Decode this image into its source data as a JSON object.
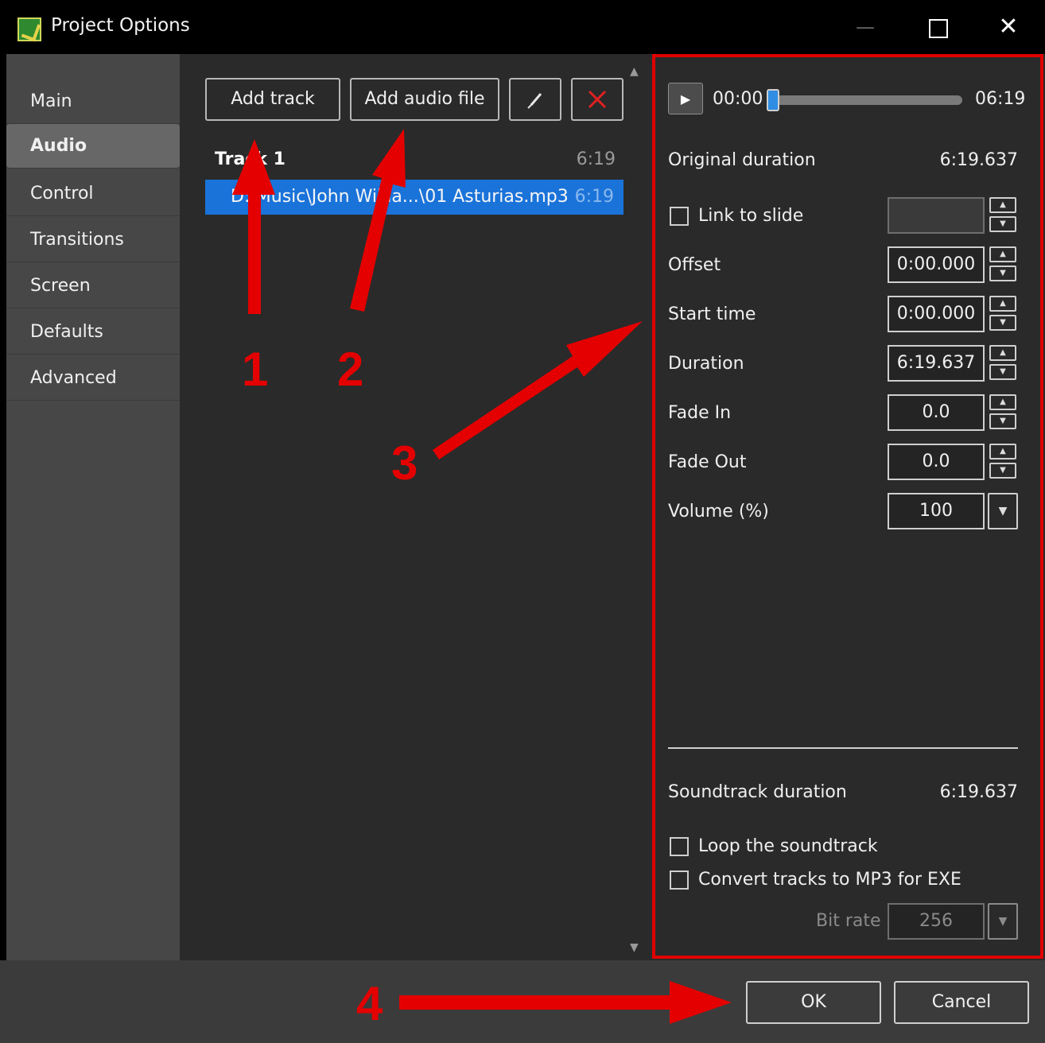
{
  "window": {
    "title": "Project Options",
    "min_label": "—",
    "close_label": "✕"
  },
  "sidebar": {
    "items": [
      {
        "label": "Main"
      },
      {
        "label": "Audio"
      },
      {
        "label": "Control"
      },
      {
        "label": "Transitions"
      },
      {
        "label": "Screen"
      },
      {
        "label": "Defaults"
      },
      {
        "label": "Advanced"
      }
    ],
    "selected": "Audio"
  },
  "toolbar": {
    "add_track": "Add track",
    "add_audio_file": "Add audio file",
    "pin_icon": "pin-icon",
    "delete_icon": "delete-x-icon"
  },
  "tracks": [
    {
      "title": "Track 1",
      "duration": "6:19",
      "files": [
        {
          "path": "D:\\Music\\John Willia...\\01 Asturias.mp3",
          "duration": "6:19"
        }
      ]
    }
  ],
  "player": {
    "current_time": "00:00",
    "total_time": "06:19",
    "progress": 0.0
  },
  "properties": {
    "original_duration_label": "Original duration",
    "original_duration": "6:19.637",
    "link_to_slide_label": "Link to slide",
    "link_to_slide_value": "",
    "offset_label": "Offset",
    "offset": "0:00.000",
    "start_time_label": "Start time",
    "start_time": "0:00.000",
    "duration_label": "Duration",
    "duration": "6:19.637",
    "fade_in_label": "Fade In",
    "fade_in": "0.0",
    "fade_out_label": "Fade Out",
    "fade_out": "0.0",
    "volume_label": "Volume (%)",
    "volume": "100",
    "soundtrack_duration_label": "Soundtrack duration",
    "soundtrack_duration": "6:19.637",
    "loop_label": "Loop the soundtrack",
    "convert_label": "Convert tracks to MP3 for EXE",
    "bit_rate_label": "Bit rate",
    "bit_rate": "256"
  },
  "buttons": {
    "ok": "OK",
    "cancel": "Cancel"
  },
  "annotations": {
    "numbers": [
      "1",
      "2",
      "3",
      "4"
    ],
    "color": "#e40000"
  },
  "colors": {
    "accent": "#1a73d9",
    "highlight_border": "#e00000"
  }
}
